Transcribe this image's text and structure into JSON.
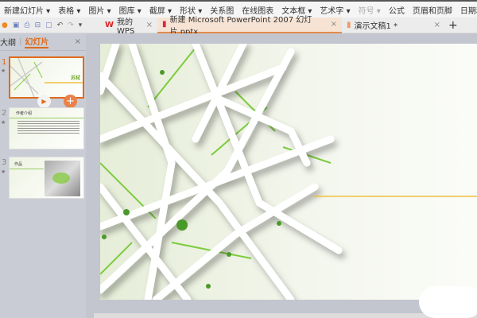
{
  "ribbon": {
    "items": [
      "新建幻灯片 ▾",
      "表格 ▾",
      "图片 ▾",
      "图库 ▾",
      "截屏 ▾",
      "形状 ▾",
      "关系图",
      "在线图表",
      "文本框 ▾",
      "艺术字 ▾",
      "符号 ▾",
      "公式",
      "页眉和页脚",
      "日期和时间"
    ]
  },
  "tabs": [
    {
      "label": "我的WPS",
      "close": "×"
    },
    {
      "label": "新建 Microsoft PowerPoint 2007 幻灯片.pptx",
      "close": "×"
    },
    {
      "label": "演示文稿1 *",
      "close": "×"
    }
  ],
  "new_tab": "+",
  "panel": {
    "tab_outline": "大纲",
    "tab_slides": "幻灯片",
    "close": "×"
  },
  "slides": [
    {
      "num": "1",
      "title": "苏轼"
    },
    {
      "num": "2",
      "title": "作者介绍"
    },
    {
      "num": "3",
      "title": "作品"
    }
  ],
  "accent": "#e06a1c"
}
